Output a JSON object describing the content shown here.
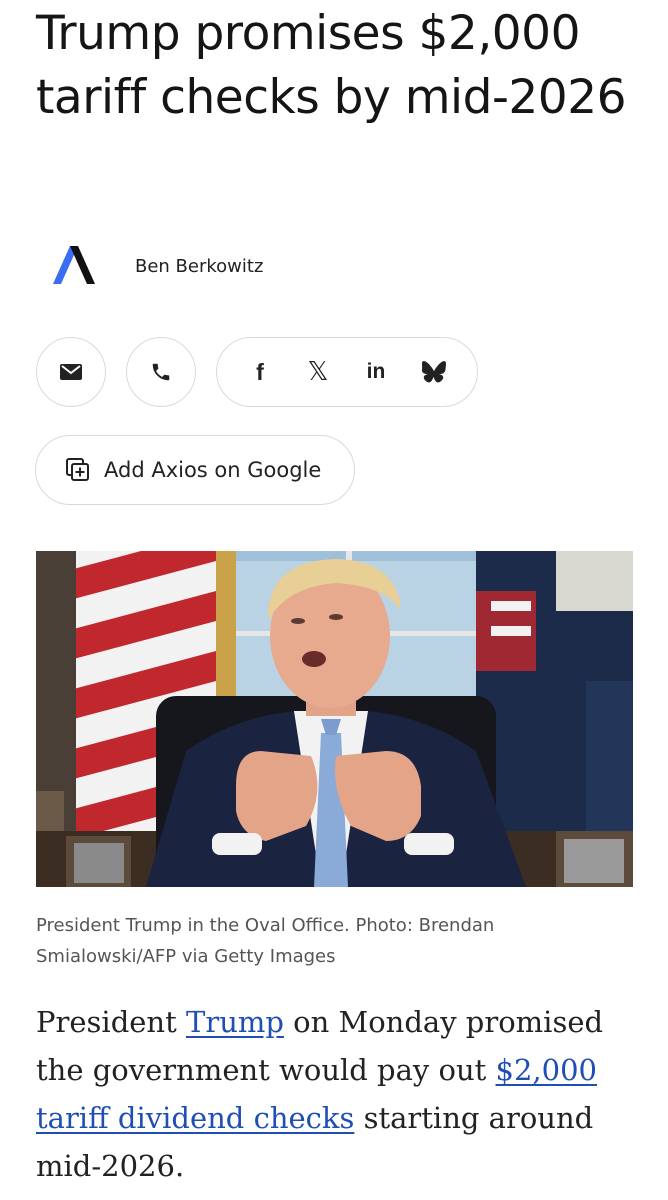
{
  "article": {
    "headline": "Trump promises $2,000 tariff checks by mid-2026",
    "author": "Ben Berkowitz"
  },
  "share": {
    "icons": [
      "email-icon",
      "phone-icon",
      "facebook-icon",
      "x-icon",
      "linkedin-icon",
      "bluesky-icon"
    ],
    "facebook_glyph": "f",
    "x_glyph": "𝕏",
    "linkedin_glyph": "in"
  },
  "google_button": {
    "label": "Add Axios on Google",
    "icon": "add-source-icon"
  },
  "photo": {
    "caption": "President Trump in the Oval Office. Photo: Brendan Smialowski/AFP via Getty Images"
  },
  "body": {
    "p1_a": "President ",
    "p1_link1": "Trump",
    "p1_b": " on Monday promised the government would pay out ",
    "p1_link2": "$2,000 tariff dividend checks",
    "p1_c": " starting around mid-2026."
  },
  "colors": {
    "link": "#1f4fb5",
    "logo_blue": "#3a6cf4",
    "logo_dark": "#111111"
  }
}
